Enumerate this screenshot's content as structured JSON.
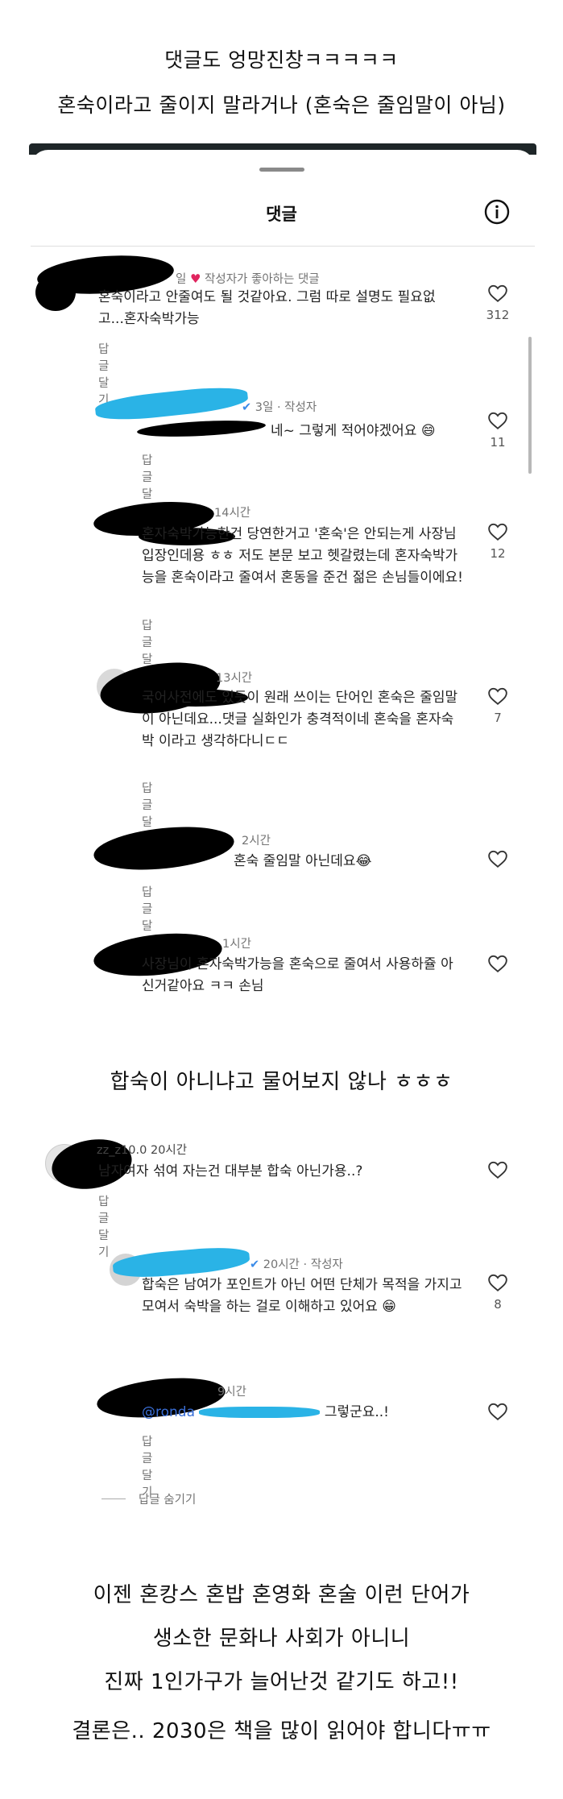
{
  "captions": {
    "line1": "댓글도 엉망진창ㅋㅋㅋㅋㅋ",
    "line2": "혼숙이라고 줄이지 말라거나 (혼숙은 줄임말이 아님)",
    "line3": "합숙이 아니냐고 물어보지 않나 ㅎㅎㅎ",
    "line4a": "이젠 혼캉스 혼밥 혼영화 혼술 이런 단어가",
    "line4b": "생소한 문화나 사회가 아니니",
    "line4c": "진짜 1인가구가 늘어난것 같기도 하고!!",
    "line5": "결론은.. 2030은 책을 많이 읽어야 합니다ㅠㅠ"
  },
  "sheet": {
    "title": "댓글",
    "reply_label": "답글 달기",
    "hide_replies_label": "답글 숨기기"
  },
  "comments": [
    {
      "time": "일",
      "meta": "작성자가 좋아하는 댓글",
      "text": "혼숙이라고 안줄여도 될 것같아요. 그럼 따로 설명도 필요없고...혼자숙박가능",
      "likes": "312"
    },
    {
      "time": "3일 · 작성자",
      "text": "네~ 그렇게 적어야겠어요 😄",
      "likes": "11"
    },
    {
      "time": "14시간",
      "text": "혼자숙박가능한건 당연한거고 '혼숙'은 안되는게 사장님 입장인데용 ㅎㅎ 저도 본문 보고 헷갈렸는데 혼자숙박가능을 혼숙이라고 줄여서 혼동을 준건 젊은 손님들이에요!",
      "likes": "12"
    },
    {
      "time": "13시간",
      "text": "국어사전에도 있듯이 원래 쓰이는 단어인 혼숙은 줄임말이 아닌데요...댓글 실화인가 충격적이네 혼숙을 혼자숙박 이라고 생각하다니ㄷㄷ",
      "likes": "7"
    },
    {
      "time": "2시간",
      "text": "혼숙 줄임말 아닌데요😂",
      "likes": ""
    },
    {
      "time": "1시간",
      "text": "사장님이 혼자숙박가능을 혼숙으로 줄여서 사용하쥴 아신거같아요 ㅋㅋ 손님",
      "likes": ""
    }
  ],
  "comments2": [
    {
      "user": "zz_z10.0",
      "time": "20시간",
      "text": "남자여자 섞여 자는건 대부분 합숙 아닌가용..?",
      "likes": ""
    },
    {
      "time": "20시간 · 작성자",
      "text": "합숙은 남여가 포인트가 아닌 어떤 단체가 목적을 가지고 모여서 숙박을 하는 걸로 이해하고 있어요 😁",
      "likes": "8"
    },
    {
      "time": "9시간",
      "mention": "@ronda",
      "text": "그렇군요..!",
      "likes": ""
    }
  ],
  "icons": {
    "info": "info-icon",
    "heart": "heart-outline-icon",
    "liked_by_author": "heart-filled-icon"
  },
  "colors": {
    "heart_red": "#e0245e",
    "mention_blue": "#3a6fd8",
    "frame_dark": "#1e2628"
  }
}
